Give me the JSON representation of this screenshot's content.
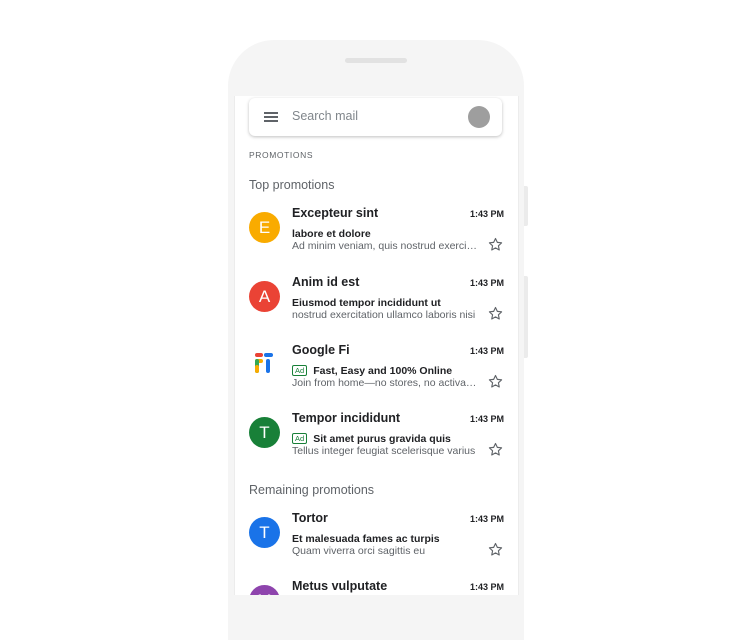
{
  "search": {
    "placeholder": "Search mail"
  },
  "section_label": "PROMOTIONS",
  "groups": {
    "top": "Top promotions",
    "remaining": "Remaining promotions"
  },
  "colors": {
    "yellow": "#f9ab00",
    "red": "#ea4335",
    "green": "#188038",
    "blue": "#1a73e8",
    "purple": "#8e44ad"
  },
  "emails": [
    {
      "avatar_letter": "E",
      "avatar_color": "#f9ab00",
      "sender": "Excepteur sint",
      "time": "1:43 PM",
      "subject": "labore et dolore",
      "snippet": "Ad minim veniam, quis nostrud exercitation",
      "ad": false
    },
    {
      "avatar_letter": "A",
      "avatar_color": "#ea4335",
      "sender": "Anim id est",
      "time": "1:43 PM",
      "subject": "Eiusmod tempor incididunt ut",
      "snippet": "nostrud exercitation ullamco laboris nisi",
      "ad": false
    },
    {
      "avatar_icon": "google-fi-logo",
      "sender": "Google Fi",
      "time": "1:43 PM",
      "ad_label": "Ad",
      "subject": "Fast, Easy and 100% Online",
      "snippet": "Join from home—no stores, no activation",
      "ad": true
    },
    {
      "avatar_letter": "T",
      "avatar_color": "#188038",
      "sender": "Tempor incididunt",
      "time": "1:43 PM",
      "ad_label": "Ad",
      "subject": "Sit amet purus gravida quis",
      "snippet": "Tellus integer feugiat scelerisque varius",
      "ad": true
    },
    {
      "avatar_letter": "T",
      "avatar_color": "#1a73e8",
      "sender": "Tortor",
      "time": "1:43 PM",
      "subject": "Et malesuada fames ac turpis",
      "snippet": "Quam viverra orci sagittis eu",
      "ad": false
    },
    {
      "avatar_letter": "M",
      "avatar_color": "#8e44ad",
      "sender": "Metus vulputate",
      "time": "1:43 PM",
      "subject": "",
      "snippet": "",
      "ad": false
    }
  ]
}
